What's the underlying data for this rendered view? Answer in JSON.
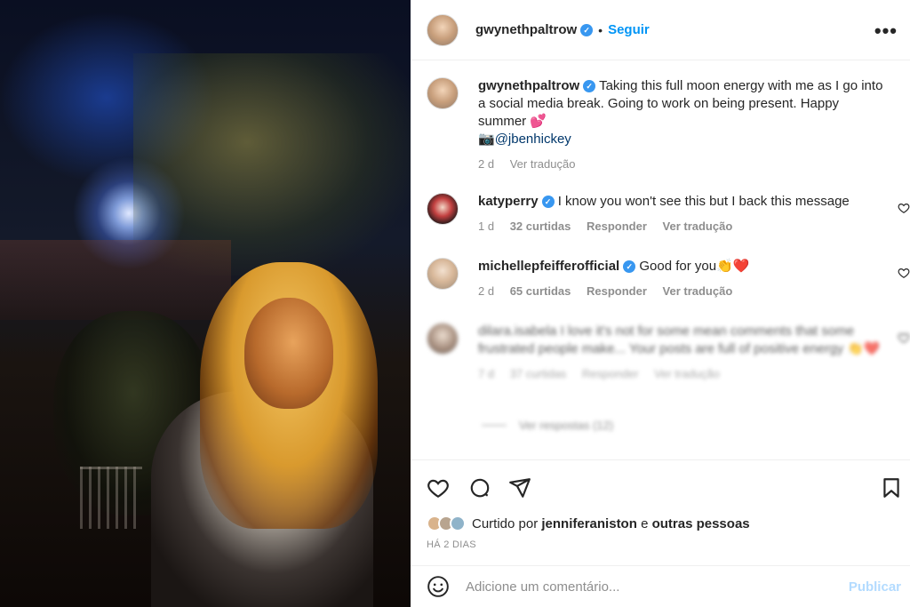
{
  "post": {
    "username": "gwynethpaltrow",
    "follow_label": "Seguir",
    "dot": "•",
    "more_label": "•••"
  },
  "caption": {
    "username": "gwynethpaltrow",
    "text": "Taking this full moon energy with me as I go into a social media break. Going to work on being present. Happy summer 💕",
    "credit_icon": "📷",
    "credit_handle": "@jbenhickey",
    "age": "2 d",
    "translate": "Ver tradução"
  },
  "comments": [
    {
      "username": "katyperry",
      "text": "I know you won't see this but I back this message",
      "age": "1 d",
      "likes": "32 curtidas",
      "reply": "Responder",
      "translate": "Ver tradução"
    },
    {
      "username": "michellepfeifferofficial",
      "text": "Good for you👏❤️",
      "age": "2 d",
      "likes": "65 curtidas",
      "reply": "Responder",
      "translate": "Ver tradução"
    },
    {
      "username": "dilara.isabela",
      "text": "I love it's not for some mean comments that some frustrated people make... Your posts are full of positive energy 👏❤️",
      "age": "7 d",
      "likes": "37 curtidas",
      "reply": "Responder",
      "translate": "Ver tradução"
    }
  ],
  "view_replies": "Ver respostas (12)",
  "liked_by": {
    "prefix": "Curtido por",
    "user": "jenniferaniston",
    "conj": "e",
    "others": "outras pessoas"
  },
  "date_label": "HÁ 2 DIAS",
  "compose": {
    "placeholder": "Adicione um comentário...",
    "publish": "Publicar"
  },
  "icons": {
    "verified": "verified-badge-icon",
    "like": "heart-icon",
    "comment": "comment-icon",
    "share": "paper-plane-icon",
    "save": "bookmark-icon",
    "emoji": "emoji-icon"
  },
  "colors": {
    "accent": "#0095f6",
    "verified": "#3897f0",
    "muted": "#8e8e8e",
    "publish_disabled": "#b3dbff"
  }
}
